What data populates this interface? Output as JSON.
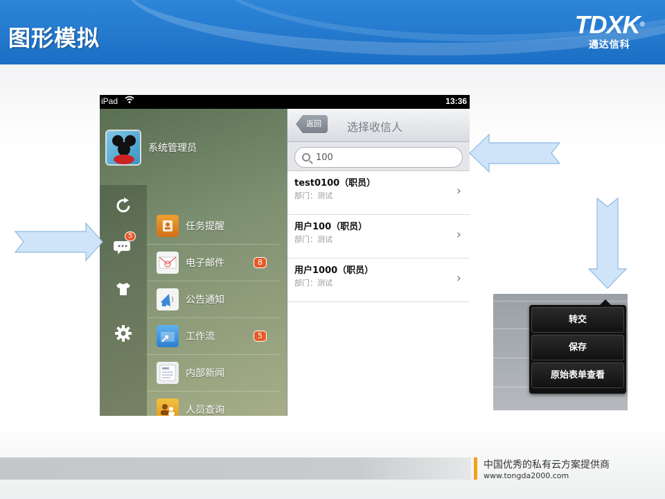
{
  "slide": {
    "title": "图形模拟",
    "brand_logo": "TDXK",
    "brand_name": "通达信科"
  },
  "ipad": {
    "status": {
      "device": "iPad",
      "time": "13:36"
    },
    "user": {
      "name": "系统管理员"
    },
    "rail": {
      "icons": [
        "refresh-icon",
        "chat-icon",
        "tshirt-icon",
        "gear-icon"
      ],
      "chat_badge": "5"
    },
    "menu": [
      {
        "label": "任务提醒",
        "icon": "task-icon",
        "badge": ""
      },
      {
        "label": "电子邮件",
        "icon": "mail-icon",
        "badge": "8"
      },
      {
        "label": "公告通知",
        "icon": "notice-icon",
        "badge": ""
      },
      {
        "label": "工作流",
        "icon": "workflow-icon",
        "badge": "5"
      },
      {
        "label": "内部新闻",
        "icon": "news-icon",
        "badge": ""
      },
      {
        "label": "人员查询",
        "icon": "people-icon",
        "badge": ""
      }
    ],
    "recipient_panel": {
      "back_label": "返回",
      "title": "选择收信人",
      "search_value": "100",
      "contacts": [
        {
          "name": "test0100（职员）",
          "dept": "部门：测试"
        },
        {
          "name": "用户100（职员）",
          "dept": "部门：测试"
        },
        {
          "name": "用户1000（职员）",
          "dept": "部门：测试"
        }
      ]
    }
  },
  "popover": {
    "items": [
      "转交",
      "保存",
      "原始表单查看"
    ]
  },
  "footer": {
    "slogan": "中国优秀的私有云方案提供商",
    "url": "www.tongda2000.com"
  },
  "colors": {
    "header_blue": "#1b6ec4",
    "arrow_fill": "#cfe4f8",
    "badge_orange": "#e65a2a",
    "footer_accent": "#f2a31b"
  }
}
